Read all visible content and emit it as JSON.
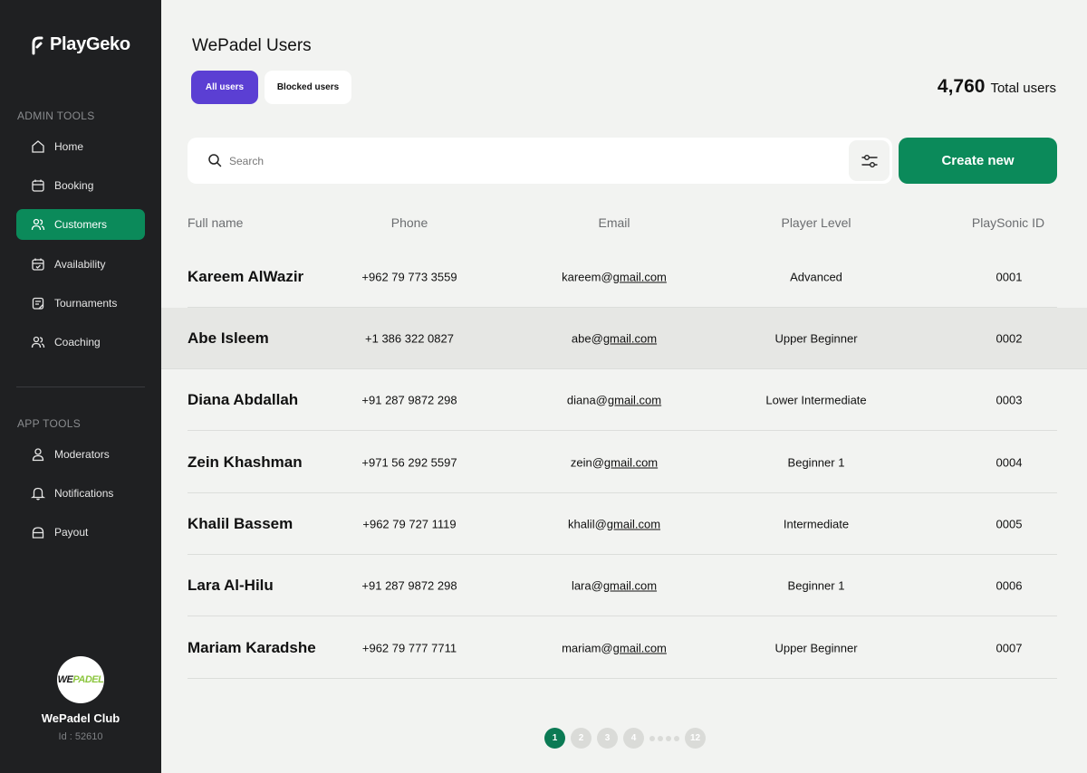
{
  "brand": {
    "name": "PlayGeko"
  },
  "sidebar": {
    "admin_label": "ADMIN TOOLS",
    "admin_items": [
      {
        "label": "Home",
        "icon": "home-icon"
      },
      {
        "label": "Booking",
        "icon": "calendar-icon"
      },
      {
        "label": "Customers",
        "icon": "users-icon",
        "active": true
      },
      {
        "label": "Availability",
        "icon": "calendar-check-icon"
      },
      {
        "label": "Tournaments",
        "icon": "clipboard-icon"
      },
      {
        "label": "Coaching",
        "icon": "users-icon"
      }
    ],
    "app_label": "APP TOOLS",
    "app_items": [
      {
        "label": "Moderators",
        "icon": "user-icon"
      },
      {
        "label": "Notifications",
        "icon": "bell-icon"
      },
      {
        "label": "Payout",
        "icon": "bag-icon"
      }
    ],
    "club": {
      "logo_we": "WE",
      "logo_padel": "PADEL",
      "name": "WePadel Club",
      "id": "Id : 52610"
    }
  },
  "header": {
    "title": "WePadel Users",
    "tabs": [
      {
        "label": "All users",
        "active": true
      },
      {
        "label": "Blocked users",
        "active": false
      }
    ],
    "total_count": "4,760",
    "total_label": "Total users"
  },
  "search": {
    "placeholder": "Search",
    "value": ""
  },
  "actions": {
    "create_label": "Create new"
  },
  "table": {
    "columns": [
      "Full name",
      "Phone",
      "Email",
      "Player Level",
      "PlaySonic ID"
    ],
    "rows": [
      {
        "name": "Kareem AlWazir",
        "phone": "+962 79 773 3559",
        "email_user": "kareem@",
        "email_domain": "gmail.com",
        "level": "Advanced",
        "id": "0001"
      },
      {
        "name": "Abe Isleem",
        "phone": "+1 386 322 0827",
        "email_user": "abe@",
        "email_domain": "gmail.com",
        "level": "Upper Beginner",
        "id": "0002"
      },
      {
        "name": "Diana Abdallah",
        "phone": "+91 287 9872 298",
        "email_user": "diana@",
        "email_domain": "gmail.com",
        "level": "Lower Intermediate",
        "id": "0003"
      },
      {
        "name": "Zein Khashman",
        "phone": "+971 56 292 5597",
        "email_user": "zein@",
        "email_domain": "gmail.com",
        "level": "Beginner 1",
        "id": "0004"
      },
      {
        "name": "Khalil Bassem",
        "phone": "+962 79 727 1119",
        "email_user": "khalil@",
        "email_domain": "gmail.com",
        "level": "Intermediate",
        "id": "0005"
      },
      {
        "name": "Lara Al-Hilu",
        "phone": "+91 287 9872 298",
        "email_user": "lara@",
        "email_domain": "gmail.com",
        "level": "Beginner 1",
        "id": "0006"
      },
      {
        "name": "Mariam Karadshe",
        "phone": "+962 79 777 7711",
        "email_user": "mariam@",
        "email_domain": "gmail.com",
        "level": "Upper Beginner",
        "id": "0007"
      }
    ]
  },
  "pagination": {
    "pages": [
      "1",
      "2",
      "3",
      "4"
    ],
    "last": "12",
    "current": "1"
  },
  "colors": {
    "accent_green": "#0b8a5a",
    "accent_purple": "#5b3fd3",
    "sidebar_bg": "#1f2022"
  }
}
